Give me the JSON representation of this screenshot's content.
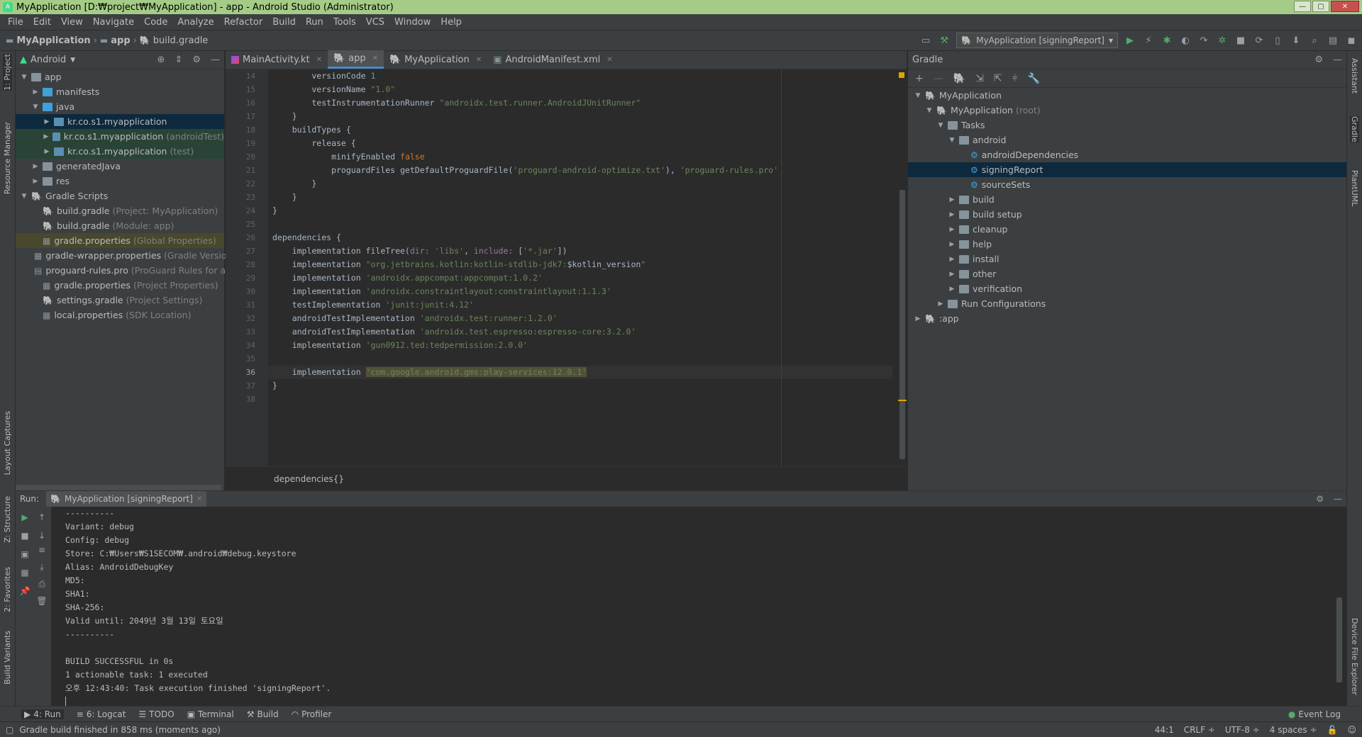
{
  "window": {
    "title": "MyApplication [D:₩project₩MyApplication] - app - Android Studio (Administrator)"
  },
  "menu": [
    "File",
    "Edit",
    "View",
    "Navigate",
    "Code",
    "Analyze",
    "Refactor",
    "Build",
    "Run",
    "Tools",
    "VCS",
    "Window",
    "Help"
  ],
  "breadcrumb": {
    "project": "MyApplication",
    "module": "app",
    "file": "build.gradle"
  },
  "toolbar": {
    "run_config": "MyApplication [signingReport]"
  },
  "left_strip": {
    "project": "1: Project",
    "resource_manager": "Resource Manager",
    "layout_captures": "Layout Captures",
    "structure": "Z: Structure",
    "favorites": "2: Favorites",
    "build_variants": "Build Variants"
  },
  "right_strip": {
    "assistant": "Assistant",
    "gradle": "Gradle",
    "plantuml": "PlantUML",
    "device_explorer": "Device File Explorer"
  },
  "project_panel": {
    "view": "Android",
    "tree": [
      {
        "label": "app",
        "extra": "",
        "depth": 0,
        "exp": "▼",
        "icon": "folder"
      },
      {
        "label": "manifests",
        "extra": "",
        "depth": 1,
        "exp": "▶",
        "icon": "folder-blue"
      },
      {
        "label": "java",
        "extra": "",
        "depth": 1,
        "exp": "▼",
        "icon": "folder-blue"
      },
      {
        "label": "kr.co.s1.myapplication",
        "extra": "",
        "depth": 2,
        "exp": "▶",
        "icon": "pkg",
        "state": "sel"
      },
      {
        "label": "kr.co.s1.myapplication",
        "extra": "(androidTest)",
        "depth": 2,
        "exp": "▶",
        "icon": "pkg",
        "state": "green"
      },
      {
        "label": "kr.co.s1.myapplication",
        "extra": "(test)",
        "depth": 2,
        "exp": "▶",
        "icon": "pkg",
        "state": "green"
      },
      {
        "label": "generatedJava",
        "extra": "",
        "depth": 1,
        "exp": "▶",
        "icon": "folder"
      },
      {
        "label": "res",
        "extra": "",
        "depth": 1,
        "exp": "▶",
        "icon": "folder"
      },
      {
        "label": "Gradle Scripts",
        "extra": "",
        "depth": 0,
        "exp": "▼",
        "icon": "gradle"
      },
      {
        "label": "build.gradle",
        "extra": "(Project: MyApplication)",
        "depth": 1,
        "exp": "",
        "icon": "gradle"
      },
      {
        "label": "build.gradle",
        "extra": "(Module: app)",
        "depth": 1,
        "exp": "",
        "icon": "gradle"
      },
      {
        "label": "gradle.properties",
        "extra": "(Global Properties)",
        "depth": 1,
        "exp": "",
        "icon": "props",
        "state": "gp"
      },
      {
        "label": "gradle-wrapper.properties",
        "extra": "(Gradle Version)",
        "depth": 1,
        "exp": "",
        "icon": "props"
      },
      {
        "label": "proguard-rules.pro",
        "extra": "(ProGuard Rules for app)",
        "depth": 1,
        "exp": "",
        "icon": "file"
      },
      {
        "label": "gradle.properties",
        "extra": "(Project Properties)",
        "depth": 1,
        "exp": "",
        "icon": "props"
      },
      {
        "label": "settings.gradle",
        "extra": "(Project Settings)",
        "depth": 1,
        "exp": "",
        "icon": "gradle"
      },
      {
        "label": "local.properties",
        "extra": "(SDK Location)",
        "depth": 1,
        "exp": "",
        "icon": "props"
      }
    ]
  },
  "editor": {
    "tabs": [
      {
        "label": "MainActivity.kt",
        "active": false
      },
      {
        "label": "app",
        "active": true
      },
      {
        "label": "MyApplication",
        "active": false
      },
      {
        "label": "AndroidManifest.xml",
        "active": false
      }
    ],
    "line_numbers": [
      "14",
      "15",
      "16",
      "17",
      "18",
      "19",
      "20",
      "21",
      "22",
      "23",
      "24",
      "25",
      "26",
      "27",
      "28",
      "29",
      "30",
      "31",
      "32",
      "33",
      "34",
      "35",
      "36",
      "37",
      "38"
    ],
    "current_line": "36",
    "breadcrumb": "dependencies{}"
  },
  "gradle_panel": {
    "title": "Gradle",
    "tree": [
      {
        "label": "MyApplication",
        "extra": "",
        "depth": 0,
        "exp": "▼",
        "icon": "gradle"
      },
      {
        "label": "MyApplication",
        "extra": "(root)",
        "depth": 1,
        "exp": "▼",
        "icon": "gradle"
      },
      {
        "label": "Tasks",
        "extra": "",
        "depth": 2,
        "exp": "▼",
        "icon": "folder"
      },
      {
        "label": "android",
        "extra": "",
        "depth": 3,
        "exp": "▼",
        "icon": "folder"
      },
      {
        "label": "androidDependencies",
        "extra": "",
        "depth": 4,
        "exp": "",
        "icon": "gear"
      },
      {
        "label": "signingReport",
        "extra": "",
        "depth": 4,
        "exp": "",
        "icon": "gear",
        "state": "sel"
      },
      {
        "label": "sourceSets",
        "extra": "",
        "depth": 4,
        "exp": "",
        "icon": "gear"
      },
      {
        "label": "build",
        "extra": "",
        "depth": 3,
        "exp": "▶",
        "icon": "folder"
      },
      {
        "label": "build setup",
        "extra": "",
        "depth": 3,
        "exp": "▶",
        "icon": "folder"
      },
      {
        "label": "cleanup",
        "extra": "",
        "depth": 3,
        "exp": "▶",
        "icon": "folder"
      },
      {
        "label": "help",
        "extra": "",
        "depth": 3,
        "exp": "▶",
        "icon": "folder"
      },
      {
        "label": "install",
        "extra": "",
        "depth": 3,
        "exp": "▶",
        "icon": "folder"
      },
      {
        "label": "other",
        "extra": "",
        "depth": 3,
        "exp": "▶",
        "icon": "folder"
      },
      {
        "label": "verification",
        "extra": "",
        "depth": 3,
        "exp": "▶",
        "icon": "folder"
      },
      {
        "label": "Run Configurations",
        "extra": "",
        "depth": 2,
        "exp": "▶",
        "icon": "folder"
      },
      {
        "label": ":app",
        "extra": "",
        "depth": 0,
        "exp": "▶",
        "icon": "gradle"
      }
    ]
  },
  "run_panel": {
    "label": "Run:",
    "tab": "MyApplication [signingReport]",
    "lines": [
      "----------",
      "Variant: debug",
      "Config: debug",
      "Store: C:₩Users₩S1SECOM₩.android₩debug.keystore",
      "Alias: AndroidDebugKey",
      "MD5: ",
      "SHA1: ",
      "SHA-256: ",
      "Valid until: 2049년 3월 13일 토요일",
      "----------",
      "",
      "BUILD SUCCESSFUL in 0s",
      "1 actionable task: 1 executed",
      "오후 12:43:40: Task execution finished 'signingReport'."
    ]
  },
  "bottom_tabs": [
    "4: Run",
    "6: Logcat",
    "TODO",
    "Terminal",
    "Build",
    "Profiler"
  ],
  "event_log": "Event Log",
  "status": {
    "message": "Gradle build finished in 858 ms (moments ago)",
    "position": "44:1",
    "line_sep": "CRLF ÷",
    "encoding": "UTF-8 ÷",
    "indent": "4 spaces ÷"
  },
  "colors": {
    "accent": "#4a88c7",
    "selection": "#0d293e",
    "keyword": "#cc7832",
    "string": "#6a8759"
  }
}
